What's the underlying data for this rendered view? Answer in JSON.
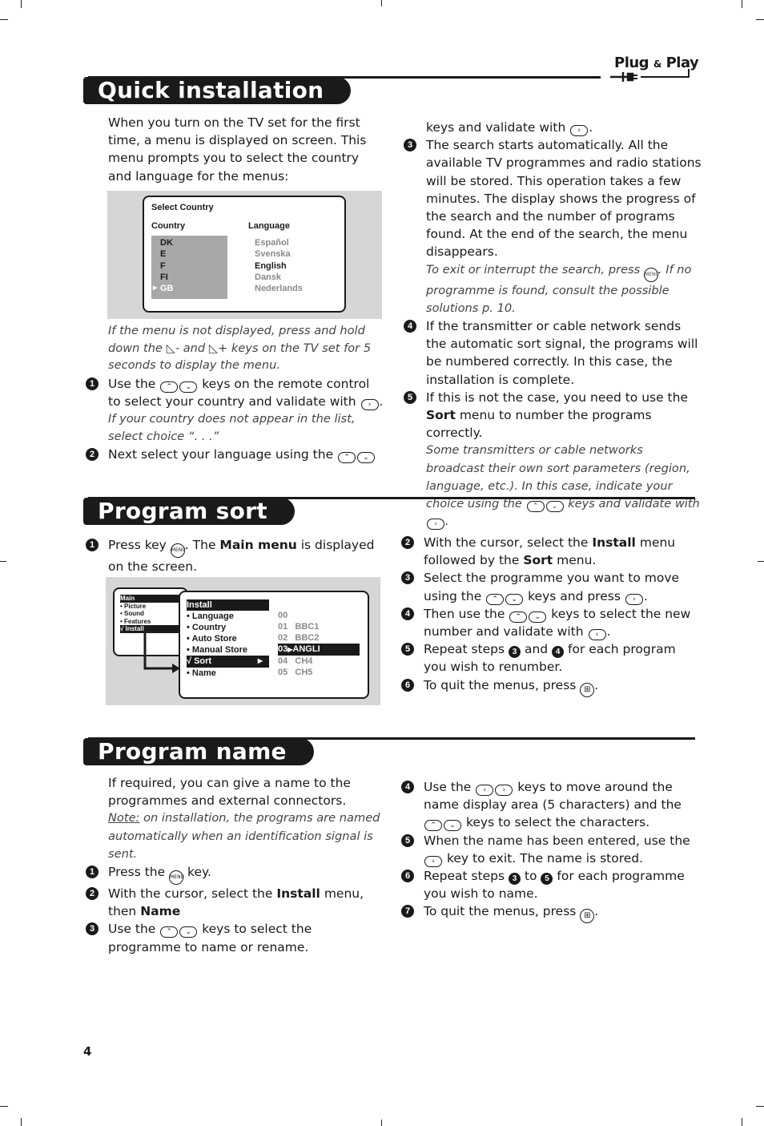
{
  "header": {
    "plug_play": "Plug",
    "plug_amp": "&",
    "plug_play2": "Play"
  },
  "quick": {
    "title": "Quick installation",
    "intro": "When you turn on the TV set for the first time, a menu is displayed on screen. This menu prompts you to select the country and language for the menus:",
    "screen": {
      "heading": "Select Country",
      "col_country": "Country",
      "col_language": "Language",
      "countries": [
        "DK",
        "E",
        "F",
        "FI",
        "GB"
      ],
      "selected_country": "GB",
      "languages": [
        "Español",
        "Svenska",
        "English",
        "Dansk",
        "Nederlands"
      ],
      "selected_language": "English"
    },
    "note": "If the menu is not displayed, press and hold down the ◺- and ◺+ keys on the TV set for 5 seconds to display the menu.",
    "step1_a": "Use the",
    "step1_b": "keys on the remote control to select your country and validate with",
    "step1_note": "If your country does not appear in the list, select choice “. . .”",
    "step2_a": "Next select your language using the",
    "step2_b": "keys and validate with",
    "step3": "The search starts automatically. All the available TV programmes and radio stations will be stored. This operation takes a few minutes. The display shows the progress of the search and the number of programs found.  At the end of the search, the menu disappears.",
    "step3_note_a": "To exit or interrupt the search, press",
    "step3_note_b": "If no programme is found, consult the possible solutions p. 10.",
    "step4": "If the transmitter or cable network sends the automatic sort signal, the programs will be numbered correctly. In this case, the installation is complete.",
    "step5_a": "If this is not the case, you need to use the",
    "step5_bold": "Sort",
    "step5_b": "menu to number the programs correctly.",
    "step5_note_a": "Some transmitters or cable networks broadcast their own sort parameters (region, language, etc.). In this case, indicate your choice using the",
    "step5_note_b": "keys and validate with"
  },
  "sort": {
    "title": "Program sort",
    "step1_a": "Press key",
    "step1_b": ". The",
    "step1_bold": "Main menu",
    "step1_c": "is displayed on the screen.",
    "mini_menu": [
      "Main",
      "• Picture",
      "• Sound",
      "• Features",
      "√ Install"
    ],
    "install_menu": [
      "Install",
      "• Language",
      "• Country",
      "• Auto Store",
      "• Manual Store",
      "√ Sort",
      "• Name"
    ],
    "programs": [
      {
        "num": "00",
        "name": ""
      },
      {
        "num": "01",
        "name": "BBC1"
      },
      {
        "num": "02",
        "name": "BBC2"
      },
      {
        "num": "03",
        "name": "ANGLI"
      },
      {
        "num": "04",
        "name": "CH4"
      },
      {
        "num": "05",
        "name": "CH5"
      }
    ],
    "step2_a": "With the cursor, select the",
    "step2_bold1": "Install",
    "step2_b": "menu followed by the",
    "step2_bold2": "Sort",
    "step2_c": "menu.",
    "step3_a": "Select the programme you want to move using the",
    "step3_b": "keys and press",
    "step4_a": "Then use the",
    "step4_b": "keys to select the new number and validate with",
    "step5_a": "Repeat steps",
    "step5_and": "and",
    "step5_b": "for each program you wish to renumber.",
    "step6": "To quit the menus, press"
  },
  "name": {
    "title": "Program name",
    "intro": "If required, you can give a name to the programmes and external connectors.",
    "note_label": "Note:",
    "note": "on installation, the programs are named automatically when an identification signal is sent.",
    "step1_a": "Press the",
    "step1_b": "key.",
    "step2_a": "With the cursor, select the",
    "step2_bold1": "Install",
    "step2_b": "menu, then",
    "step2_bold2": "Name",
    "step3_a": "Use the",
    "step3_b": "keys to select the programme to name or rename.",
    "step4_a": "Use the",
    "step4_b": "keys to move around the name display area (5 characters) and the",
    "step4_c": "keys to select the characters.",
    "step5_a": "When the name has been entered, use the",
    "step5_b": "key to exit. The name is stored.",
    "step6_a": "Repeat steps",
    "step6_to": "to",
    "step6_b": "for each programme you wish to name.",
    "step7": "To quit the menus, press"
  },
  "page_number": "4",
  "icons": {
    "menu_key": "MENU",
    "up": "⌃",
    "down": "⌄",
    "left": "‹",
    "right": "›",
    "tv": "⊞"
  }
}
